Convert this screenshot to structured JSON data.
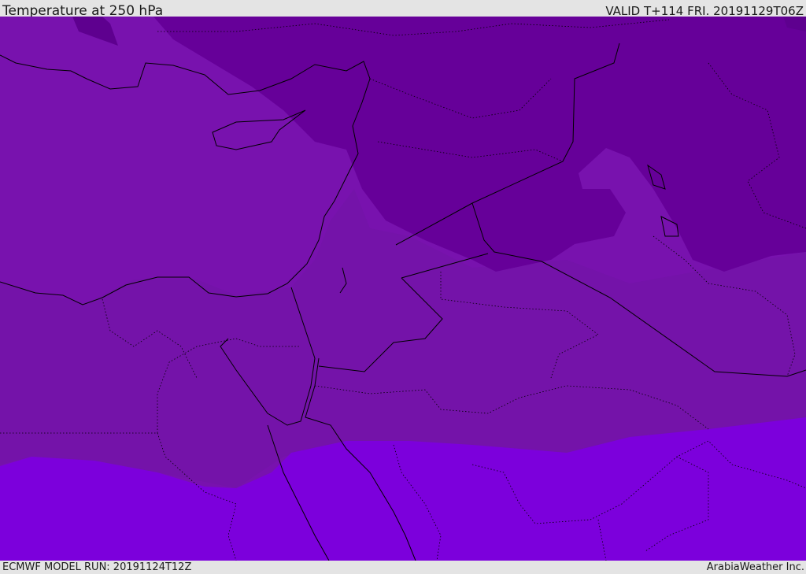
{
  "header": {
    "title": "Temperature at 250 hPa",
    "valid": "VALID T+114 FRI. 20191129T06Z"
  },
  "footer": {
    "model_run": "ECMWF MODEL RUN: 20191124T12Z",
    "credit": "ArabiaWeather Inc."
  },
  "map": {
    "variable": "Temperature",
    "level": "250 hPa",
    "colors": {
      "mid": "#7812ae",
      "land_mid": "#7413a9",
      "cold": "#660099",
      "colder": "#5c008c",
      "warm": "#7c00dc",
      "coast": "#000000"
    }
  }
}
